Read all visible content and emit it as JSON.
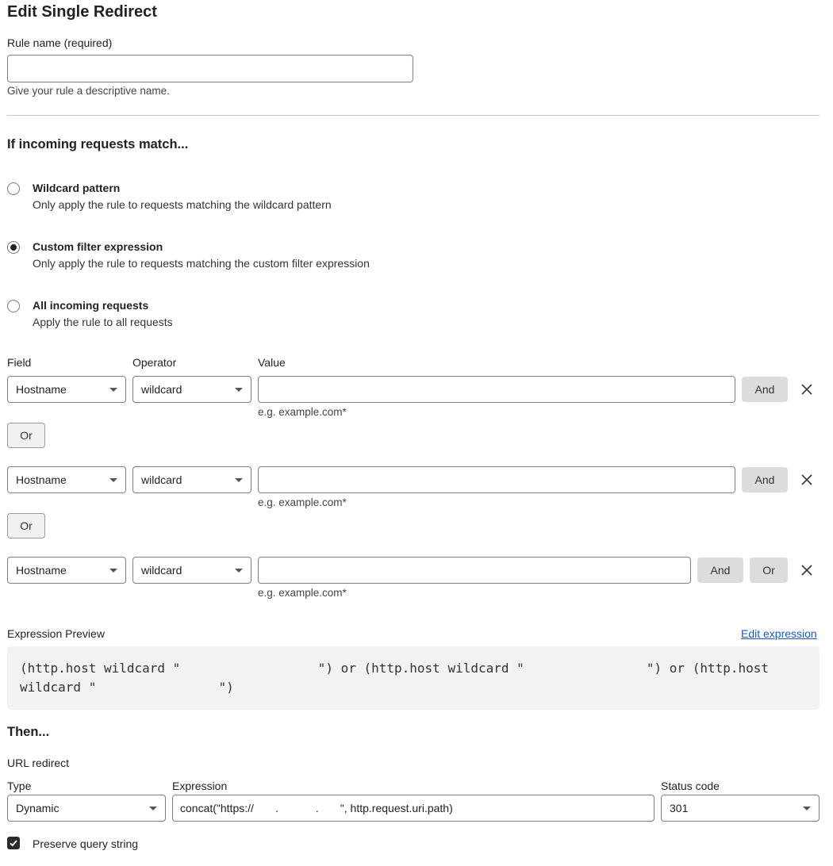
{
  "page": {
    "title": "Edit Single Redirect"
  },
  "rule_name": {
    "label": "Rule name (required)",
    "value": "",
    "help": "Give your rule a descriptive name."
  },
  "match": {
    "heading": "If incoming requests match...",
    "options": [
      {
        "title": "Wildcard pattern",
        "desc": "Only apply the rule to requests matching the wildcard pattern",
        "checked": false
      },
      {
        "title": "Custom filter expression",
        "desc": "Only apply the rule to requests matching the custom filter expression",
        "checked": true
      },
      {
        "title": "All incoming requests",
        "desc": "Apply the rule to all requests",
        "checked": false
      }
    ]
  },
  "filter": {
    "field_label": "Field",
    "operator_label": "Operator",
    "value_label": "Value",
    "rows": [
      {
        "field": "Hostname",
        "operator": "wildcard",
        "value": "",
        "example": "e.g. example.com*",
        "and": "And"
      },
      {
        "field": "Hostname",
        "operator": "wildcard",
        "value": "",
        "example": "e.g. example.com*",
        "and": "And"
      },
      {
        "field": "Hostname",
        "operator": "wildcard",
        "value": "",
        "example": "e.g. example.com*",
        "and": "And",
        "or": "Or"
      }
    ],
    "or_button": "Or"
  },
  "expression_preview": {
    "label": "Expression Preview",
    "edit_link": "Edit expression",
    "line1": "(http.host wildcard \"                  \") or (http.host wildcard \"                \") or (http.host",
    "line2": "wildcard \"                \")"
  },
  "then": {
    "heading": "Then...",
    "redirect_label": "URL redirect",
    "type_label": "Type",
    "type_value": "Dynamic",
    "expression_label": "Expression",
    "expression_value": "concat(\"https://       .            .       \", http.request.uri.path)",
    "status_label": "Status code",
    "status_value": "301",
    "preserve_label": "Preserve query string",
    "preserve_checked": true
  },
  "icons": {
    "remove": "close-icon",
    "caret": "chevron-down-icon",
    "check": "check-icon"
  }
}
